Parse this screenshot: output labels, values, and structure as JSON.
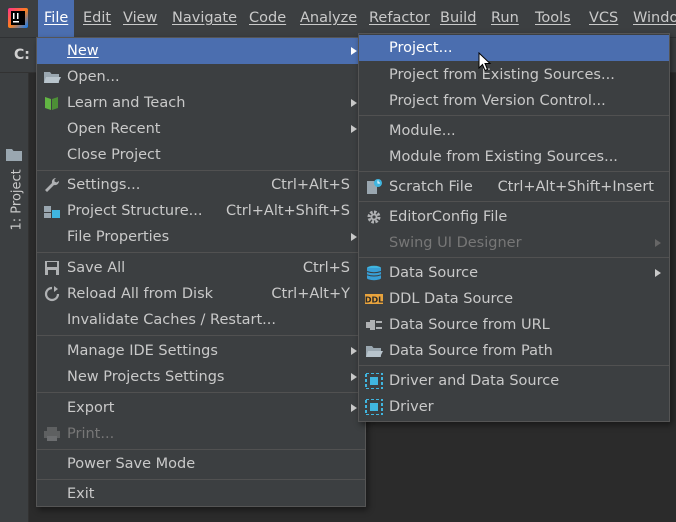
{
  "menubar": {
    "items": [
      {
        "label": "File",
        "active": true
      },
      {
        "label": "Edit"
      },
      {
        "label": "View"
      },
      {
        "label": "Navigate"
      },
      {
        "label": "Code"
      },
      {
        "label": "Analyze"
      },
      {
        "label": "Refactor"
      },
      {
        "label": "Build"
      },
      {
        "label": "Run"
      },
      {
        "label": "Tools"
      },
      {
        "label": "VCS"
      },
      {
        "label": "Windo"
      }
    ]
  },
  "toolbar": {
    "label": "C:"
  },
  "sidebar": {
    "project_tab": "1: Project"
  },
  "file_menu": {
    "items": [
      {
        "label": "New",
        "mnemonic_underline": true,
        "submenu": true,
        "highlighted": true
      },
      {
        "label": "Open...",
        "icon": "folder-open-icon"
      },
      {
        "label": "Learn and Teach",
        "icon": "book-icon",
        "submenu": true
      },
      {
        "label": "Open Recent",
        "submenu": true
      },
      {
        "label": "Close Project"
      },
      {
        "label": "Settings...",
        "icon": "wrench-icon",
        "shortcut": "Ctrl+Alt+S"
      },
      {
        "label": "Project Structure...",
        "icon": "project-structure-icon",
        "shortcut": "Ctrl+Alt+Shift+S"
      },
      {
        "label": "File Properties",
        "submenu": true
      },
      {
        "label": "Save All",
        "icon": "save-icon",
        "shortcut": "Ctrl+S"
      },
      {
        "label": "Reload All from Disk",
        "icon": "reload-icon",
        "shortcut": "Ctrl+Alt+Y"
      },
      {
        "label": "Invalidate Caches / Restart..."
      },
      {
        "label": "Manage IDE Settings",
        "submenu": true
      },
      {
        "label": "New Projects Settings",
        "submenu": true
      },
      {
        "label": "Export",
        "submenu": true
      },
      {
        "label": "Print...",
        "icon": "print-icon",
        "disabled": true
      },
      {
        "label": "Power Save Mode"
      },
      {
        "label": "Exit"
      }
    ]
  },
  "new_menu": {
    "items": [
      {
        "label": "Project...",
        "highlighted": true
      },
      {
        "label": "Project from Existing Sources..."
      },
      {
        "label": "Project from Version Control..."
      },
      {
        "label": "Module..."
      },
      {
        "label": "Module from Existing Sources..."
      },
      {
        "label": "Scratch File",
        "icon": "scratch-file-icon",
        "shortcut": "Ctrl+Alt+Shift+Insert"
      },
      {
        "label": "EditorConfig File",
        "icon": "gear-icon"
      },
      {
        "label": "Swing UI Designer",
        "disabled": true,
        "submenu": true
      },
      {
        "label": "Data Source",
        "icon": "database-icon",
        "submenu": true
      },
      {
        "label": "DDL Data Source",
        "icon": "ddl-icon"
      },
      {
        "label": "Data Source from URL",
        "icon": "plug-icon"
      },
      {
        "label": "Data Source from Path",
        "icon": "folder-icon"
      },
      {
        "label": "Driver and Data Source",
        "icon": "driver-icon"
      },
      {
        "label": "Driver",
        "icon": "driver-icon"
      }
    ]
  },
  "colors": {
    "highlight": "#4b6eaf",
    "menu_bg": "#3c3f41",
    "editor_bg": "#2b2b2b"
  }
}
